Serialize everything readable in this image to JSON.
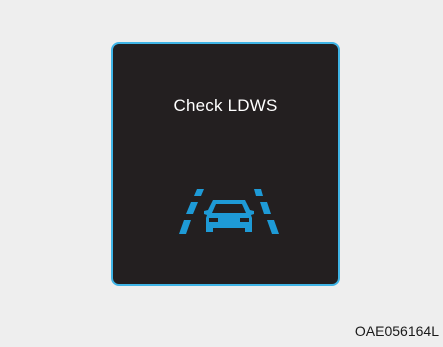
{
  "panel": {
    "message": "Check LDWS",
    "icon": "lane-departure-warning-icon",
    "colors": {
      "background": "#231f20",
      "border": "#3fb4e6",
      "text": "#ffffff",
      "icon": "#1e9ad6"
    }
  },
  "figure": {
    "code": "OAE056164L"
  }
}
